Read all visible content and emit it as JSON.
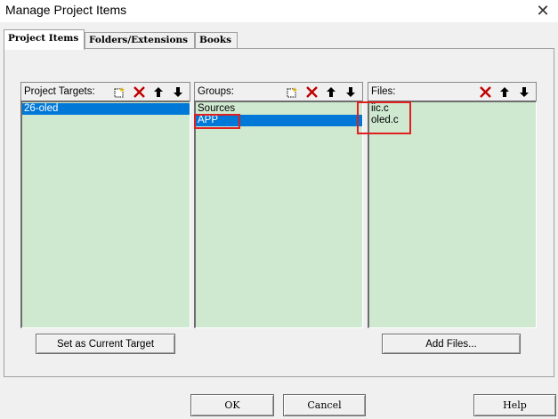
{
  "window": {
    "title": "Manage Project Items",
    "close_glyph": "✕"
  },
  "tabs": [
    {
      "label": "Project Items",
      "active": true
    },
    {
      "label": "Folders/Extensions",
      "active": false
    },
    {
      "label": "Books",
      "active": false
    }
  ],
  "panes": {
    "targets": {
      "label": "Project Targets:",
      "items": [
        {
          "text": "26-oled",
          "selected": true
        }
      ]
    },
    "groups": {
      "label": "Groups:",
      "items": [
        {
          "text": "Sources",
          "selected": false
        },
        {
          "text": "APP",
          "selected": true
        }
      ]
    },
    "files": {
      "label": "Files:",
      "items": [
        {
          "text": "iic.c",
          "selected": false
        },
        {
          "text": "oled.c",
          "selected": false
        }
      ]
    }
  },
  "icons": {
    "new": "new-item-icon",
    "delete": "delete-icon",
    "up": "move-up-icon",
    "down": "move-down-icon"
  },
  "buttons": {
    "set_current_target": "Set as Current Target",
    "add_files": "Add Files...",
    "ok": "OK",
    "cancel": "Cancel",
    "help": "Help"
  },
  "colors": {
    "list_bg": "#cfe8d0",
    "selection": "#0078d7",
    "highlight_box": "#e02020"
  }
}
